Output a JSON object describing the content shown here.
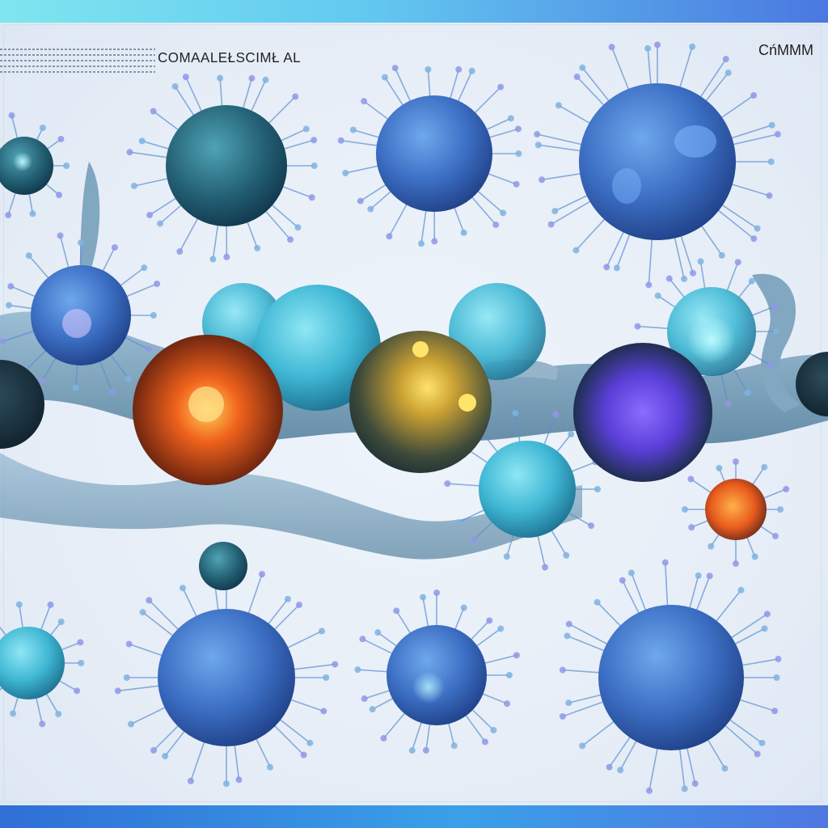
{
  "header": {
    "title": "COMAALEŁSCIMŁ AL",
    "corner_title": "CńMMM"
  },
  "palette": {
    "band_top": "#62c8f0",
    "band_bottom": "#2f6fd6",
    "cell_blue": "#3c6fc4",
    "cell_cyan": "#3fb7d4",
    "cell_orange": "#f0621c",
    "cell_yellow": "#d9b22a",
    "cell_violet": "#5a3fd8",
    "tissue": "#6f9ab8"
  },
  "illustration": {
    "subject": "virus-cell-cluster"
  }
}
